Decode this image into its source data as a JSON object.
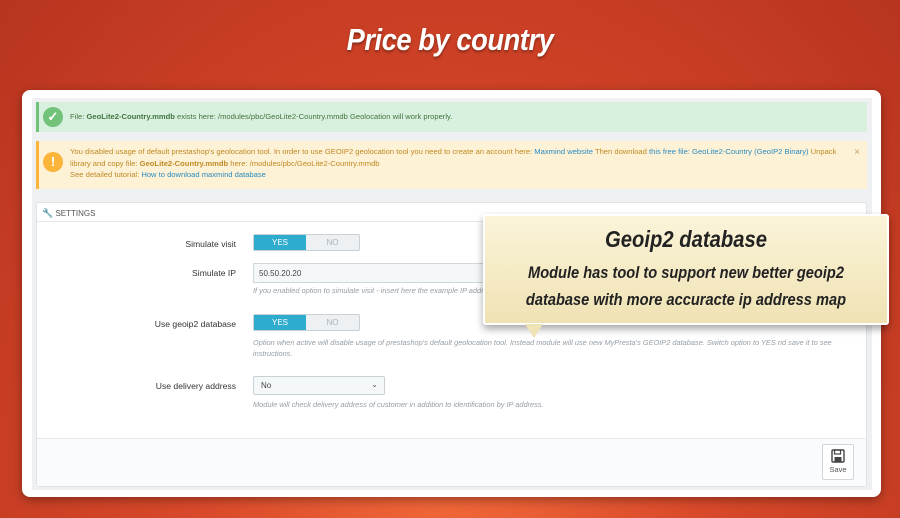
{
  "banner": {
    "title": "Price by country"
  },
  "alerts": {
    "success": {
      "prefix": "File: ",
      "filename": "GeoLite2-Country.mmdb",
      "suffix": " exists here: /modules/pbc/GeoLite2-Country.mmdb Geolocation will work properly."
    },
    "warning": {
      "text1": "You disabled usage of default prestashop's geolocation tool. In order to use GEOIP2 geolocation tool you need to create an account here: ",
      "link1": "Maxmind website",
      "text2": " Then download ",
      "link2": "this free file: GeoLite2-Country (GeoIP2 Binary)",
      "text3": " Unpack library and copy file: ",
      "filename": "GeoLite2-Country.mmdb",
      "text4": " here: /modules/pbc/GeoLite2-Country.mmdb",
      "tutorial_prefix": "See detailed tutorial: ",
      "tutorial_link": "How to download maxmind database",
      "close": "×"
    }
  },
  "panel": {
    "heading": "SETTINGS",
    "simulate_visit": {
      "label": "Simulate visit",
      "yes": "YES",
      "no": "NO"
    },
    "simulate_ip": {
      "label": "Simulate IP",
      "value": "50.50.20.20",
      "help": "If you enabled option to simulate visit - insert here the example IP address"
    },
    "geoip2": {
      "label": "Use geoip2 database",
      "yes": "YES",
      "no": "NO",
      "help": "Option when active will disable usage of prestashop's default geolocation tool. Instead module will use new MyPresta's GEOIP2 database. Switch option to YES nd save it to see instructions."
    },
    "delivery": {
      "label": "Use delivery address",
      "value": "No",
      "help": "Module will check delivery address of customer in addition to identification by IP address."
    },
    "save_label": "Save"
  },
  "callout": {
    "title": "Geoip2 database",
    "line1": "Module has tool to support new better geoip2",
    "line2": "database with more accuracte ip address map"
  },
  "colors": {
    "background": "#d9492a",
    "toggle_on": "#2eacce",
    "success": "#72c279",
    "warning": "#fbb53b",
    "link": "#2a8cc0"
  }
}
